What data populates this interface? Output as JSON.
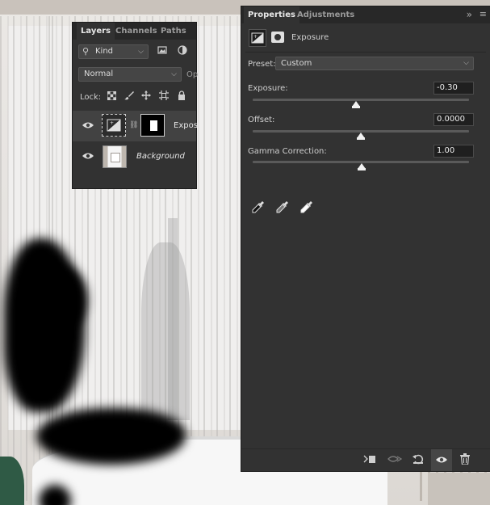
{
  "layers_panel": {
    "tabs": [
      "Layers",
      "Channels",
      "Paths"
    ],
    "filter": {
      "value": "Kind"
    },
    "blend_mode": {
      "value": "Normal",
      "opacity_label": "Op"
    },
    "lock_label": "Lock:",
    "layers": [
      {
        "name": "Expos",
        "selected": true
      },
      {
        "name": "Background",
        "selected": false
      }
    ]
  },
  "properties_panel": {
    "tabs": [
      "Properties",
      "Adjustments"
    ],
    "header_title": "Exposure",
    "preset": {
      "label": "Preset:",
      "value": "Custom"
    },
    "controls": [
      {
        "label": "Exposure:",
        "value": "-0.30",
        "position": 0.46
      },
      {
        "label": "Offset:",
        "value": "0.0000",
        "position": 0.5
      },
      {
        "label": "Gamma Correction:",
        "value": "1.00",
        "position": 0.5
      }
    ]
  },
  "colors": {
    "panel_bg": "#323232",
    "tab_bar_bg": "#282828",
    "field_bg": "#454545",
    "selected_row": "#424242"
  }
}
